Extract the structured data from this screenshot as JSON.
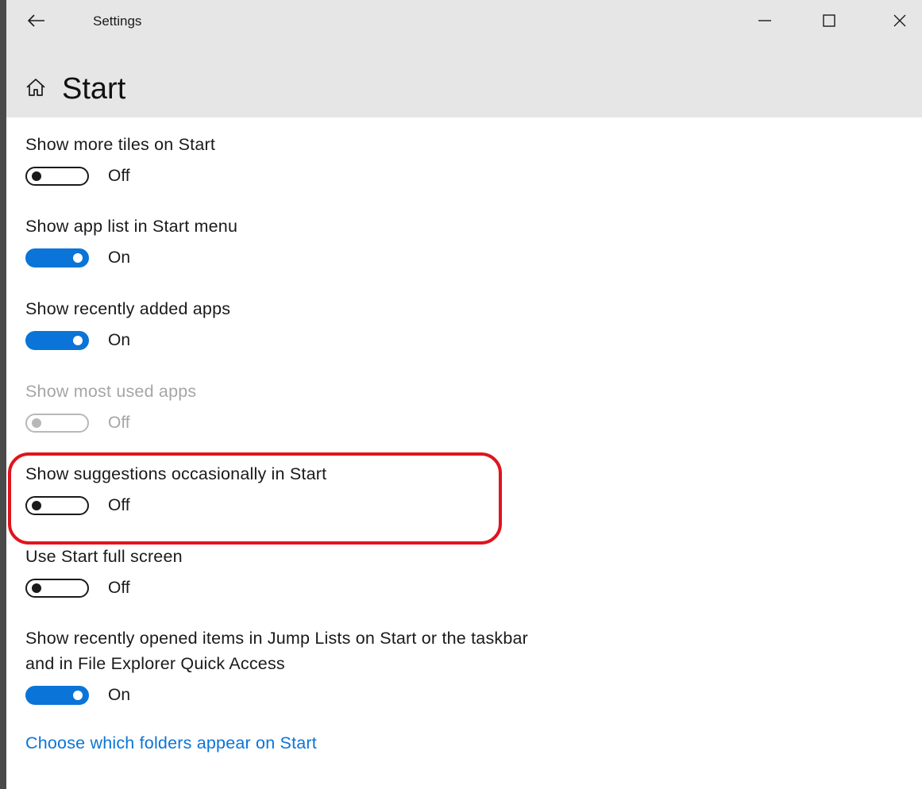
{
  "window": {
    "title": "Settings",
    "icons": {
      "back": "back-arrow-icon",
      "minimize": "minimize-icon",
      "maximize": "maximize-icon",
      "close": "close-icon",
      "home": "home-icon"
    }
  },
  "page": {
    "title": "Start"
  },
  "settings": [
    {
      "label": "Show more tiles on Start",
      "state": "Off",
      "enabled": true
    },
    {
      "label": "Show app list in Start menu",
      "state": "On",
      "enabled": true
    },
    {
      "label": "Show recently added apps",
      "state": "On",
      "enabled": true
    },
    {
      "label": "Show most used apps",
      "state": "Off",
      "enabled": false
    },
    {
      "label": "Show suggestions occasionally in Start",
      "state": "Off",
      "enabled": true,
      "highlighted": true
    },
    {
      "label": "Use Start full screen",
      "state": "Off",
      "enabled": true
    },
    {
      "label": "Show recently opened items in Jump Lists on Start or the taskbar and in File Explorer Quick Access",
      "label_line1": "Show recently opened items in Jump Lists on Start or the taskbar",
      "label_line2": "and in File Explorer Quick Access",
      "state": "On",
      "enabled": true
    }
  ],
  "link": {
    "text": "Choose which folders appear on Start"
  },
  "colors": {
    "accent": "#0a74d8",
    "highlight": "#e0141e",
    "header_bg": "#e6e6e6",
    "disabled_text": "#a6a6a6"
  }
}
